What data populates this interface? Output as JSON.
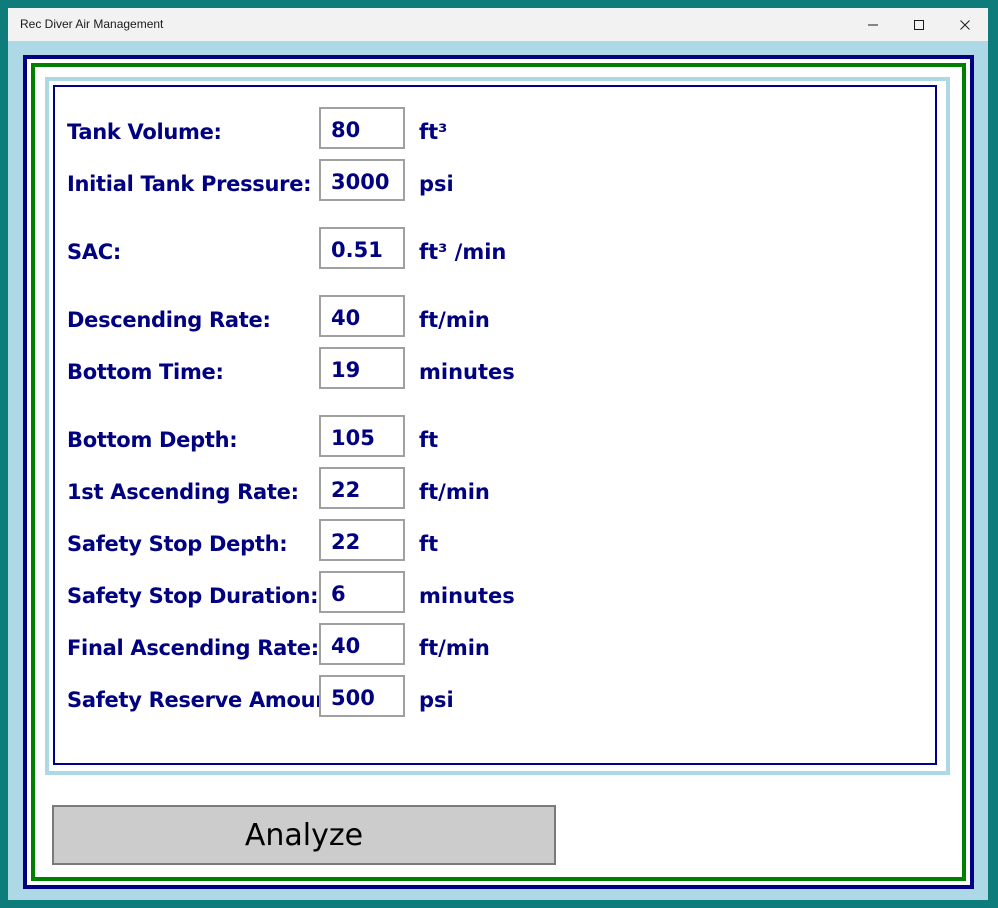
{
  "window": {
    "title": "Rec Diver Air Management",
    "controls": {
      "minimize": "minimize-icon",
      "maximize": "maximize-icon",
      "close": "close-icon"
    }
  },
  "colors": {
    "desktop": "#0e7c7b",
    "window_bg": "#add8e6",
    "outer_border": "#000080",
    "green_border": "#008000",
    "text": "#000080",
    "button_bg": "#cccccc"
  },
  "fields": [
    {
      "label": "Tank Volume:",
      "value": "80",
      "unit": "ft³"
    },
    {
      "label": "Initial Tank Pressure:",
      "value": "3000",
      "unit": "psi"
    },
    {
      "label": "SAC:",
      "value": "0.51",
      "unit": "ft³ /min"
    },
    {
      "label": "Descending Rate:",
      "value": "40",
      "unit": "ft/min"
    },
    {
      "label": "Bottom Time:",
      "value": "19",
      "unit": "minutes"
    },
    {
      "label": "Bottom Depth:",
      "value": "105",
      "unit": "ft"
    },
    {
      "label": "1st Ascending Rate:",
      "value": "22",
      "unit": "ft/min"
    },
    {
      "label": "Safety Stop Depth:",
      "value": "22",
      "unit": "ft"
    },
    {
      "label": "Safety Stop Duration:",
      "value": "6",
      "unit": "minutes"
    },
    {
      "label": "Final Ascending Rate:",
      "value": "40",
      "unit": "ft/min"
    },
    {
      "label": "Safety Reserve Amount:",
      "value": "500",
      "unit": "psi"
    }
  ],
  "actions": {
    "analyze_label": "Analyze"
  }
}
